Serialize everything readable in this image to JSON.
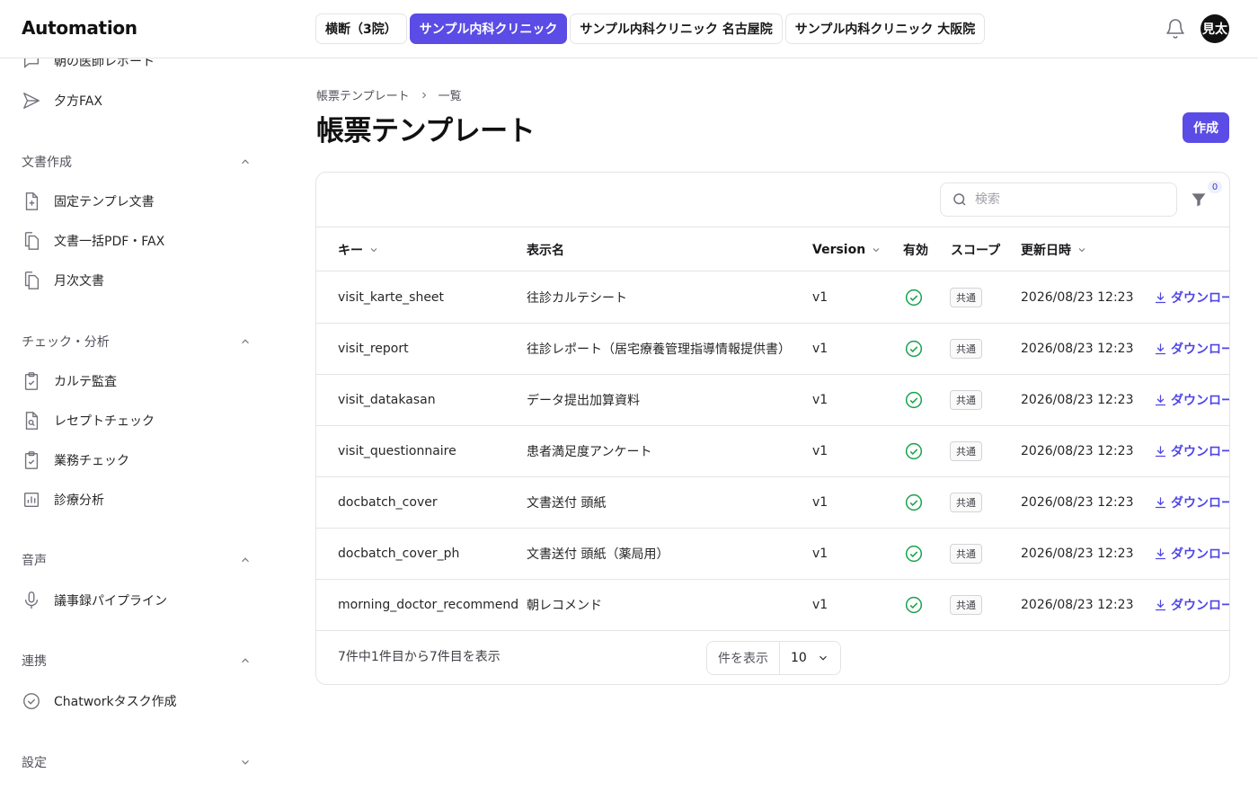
{
  "header": {
    "app_title": "Automation",
    "clinic_tabs": [
      {
        "label": "横断（3院）",
        "active": false
      },
      {
        "label": "サンプル内科クリニック",
        "active": true
      },
      {
        "label": "サンプル内科クリニック 名古屋院",
        "active": false
      },
      {
        "label": "サンプル内科クリニック 大阪院",
        "active": false
      }
    ],
    "notification_icon": "bell-icon",
    "avatar_text": "見太"
  },
  "sidebar": {
    "top_items": [
      {
        "label": "朝の医師レポート",
        "icon": "chat-icon"
      },
      {
        "label": "夕方FAX",
        "icon": "send-icon"
      }
    ],
    "sections": [
      {
        "title": "文書作成",
        "expanded": true,
        "items": [
          {
            "label": "固定テンプレ文書",
            "icon": "file-plus-icon"
          },
          {
            "label": "文書一括PDF・FAX",
            "icon": "files-icon"
          },
          {
            "label": "月次文書",
            "icon": "files-icon"
          }
        ]
      },
      {
        "title": "チェック・分析",
        "expanded": true,
        "items": [
          {
            "label": "カルテ監査",
            "icon": "clipboard-check-icon"
          },
          {
            "label": "レセプトチェック",
            "icon": "file-search-icon"
          },
          {
            "label": "業務チェック",
            "icon": "clipboard-check-icon"
          },
          {
            "label": "診療分析",
            "icon": "bar-chart-icon"
          }
        ]
      },
      {
        "title": "音声",
        "expanded": true,
        "items": [
          {
            "label": "議事録パイプライン",
            "icon": "mic-icon"
          }
        ]
      },
      {
        "title": "連携",
        "expanded": true,
        "items": [
          {
            "label": "Chatworkタスク作成",
            "icon": "check-circle-icon"
          }
        ]
      },
      {
        "title": "設定",
        "expanded": false,
        "items": []
      }
    ]
  },
  "main": {
    "breadcrumb": [
      "帳票テンプレート",
      "一覧"
    ],
    "title": "帳票テンプレート",
    "create_label": "作成",
    "search_placeholder": "検索",
    "filter_count": "0",
    "columns": {
      "key": "キー",
      "display_name": "表示名",
      "version": "Version",
      "enabled": "有効",
      "scope": "スコープ",
      "updated_at": "更新日時"
    },
    "rows": [
      {
        "key": "visit_karte_sheet",
        "name": "往診カルテシート",
        "version": "v1",
        "enabled": true,
        "scope": "共通",
        "updated": "2026/08/23 12:23",
        "action": "ダウンロー"
      },
      {
        "key": "visit_report",
        "name": "往診レポート（居宅療養管理指導情報提供書）",
        "version": "v1",
        "enabled": true,
        "scope": "共通",
        "updated": "2026/08/23 12:23",
        "action": "ダウンロー"
      },
      {
        "key": "visit_datakasan",
        "name": "データ提出加算資料",
        "version": "v1",
        "enabled": true,
        "scope": "共通",
        "updated": "2026/08/23 12:23",
        "action": "ダウンロー"
      },
      {
        "key": "visit_questionnaire",
        "name": "患者満足度アンケート",
        "version": "v1",
        "enabled": true,
        "scope": "共通",
        "updated": "2026/08/23 12:23",
        "action": "ダウンロー"
      },
      {
        "key": "docbatch_cover",
        "name": "文書送付 頭紙",
        "version": "v1",
        "enabled": true,
        "scope": "共通",
        "updated": "2026/08/23 12:23",
        "action": "ダウンロー"
      },
      {
        "key": "docbatch_cover_ph",
        "name": "文書送付 頭紙（薬局用）",
        "version": "v1",
        "enabled": true,
        "scope": "共通",
        "updated": "2026/08/23 12:23",
        "action": "ダウンロー"
      },
      {
        "key": "morning_doctor_recommend",
        "name": "朝レコメンド",
        "version": "v1",
        "enabled": true,
        "scope": "共通",
        "updated": "2026/08/23 12:23",
        "action": "ダウンロー"
      }
    ],
    "footer_info": "7件中1件目から7件目を表示",
    "per_page_label": "件を表示",
    "per_page_value": "10"
  },
  "colors": {
    "accent": "#5b4ce6",
    "success": "#16a34a",
    "link": "#4f46e5",
    "border": "#e4e4e7"
  }
}
